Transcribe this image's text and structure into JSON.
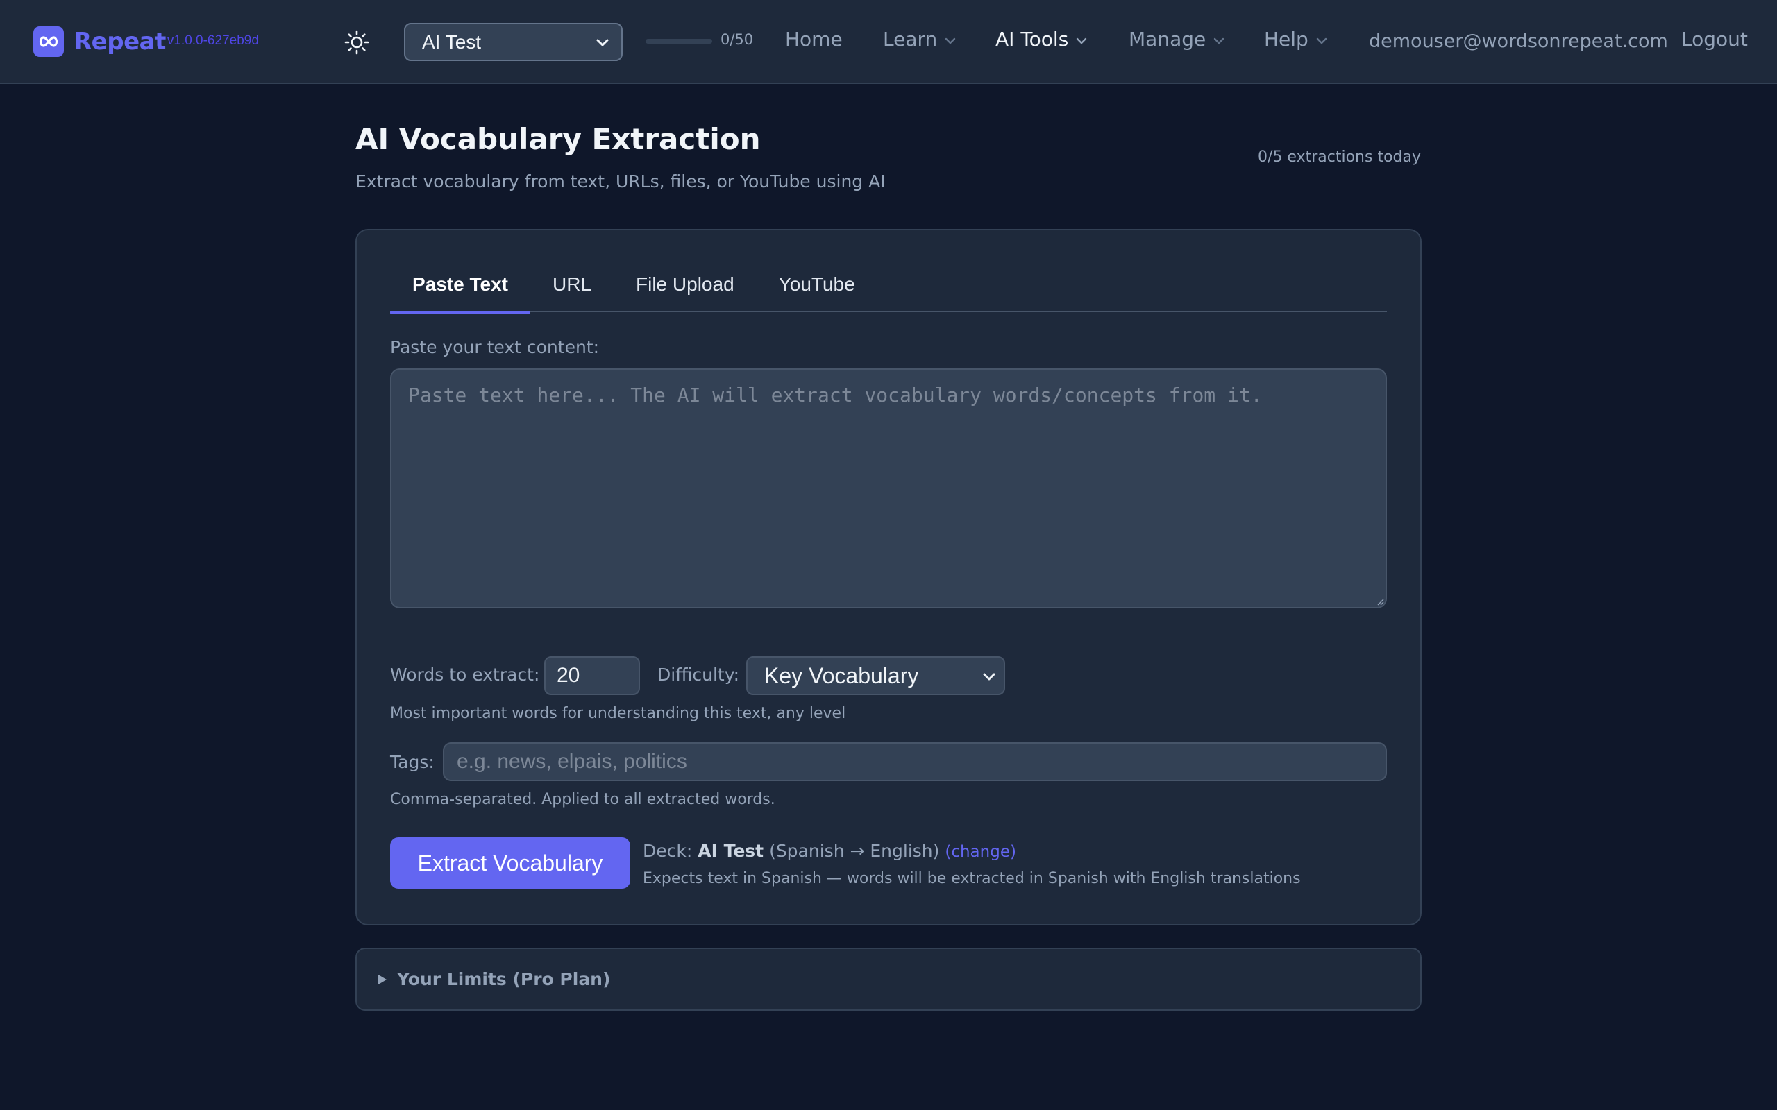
{
  "nav": {
    "brand_name": "Repeat",
    "version": "v1.0.0-627eb9d",
    "deck_selected": "AI Test",
    "progress_text": "0/50",
    "progress_fraction": 0,
    "items": {
      "home": "Home",
      "learn": "Learn",
      "ai_tools": "AI Tools",
      "manage": "Manage",
      "help": "Help"
    },
    "email": "demouser@wordsonrepeat.com",
    "logout": "Logout",
    "icons": {
      "logo": "infinity-icon",
      "theme": "sun-icon",
      "dropdown": "chevron-down-icon"
    },
    "accent_color": "#6366f1"
  },
  "header": {
    "title": "AI Vocabulary Extraction",
    "subtitle": "Extract vocabulary from text, URLs, files, or YouTube using AI",
    "extraction_count": "0/5 extractions today"
  },
  "form": {
    "tabs": [
      {
        "label": "Paste Text",
        "active": true
      },
      {
        "label": "URL",
        "active": false
      },
      {
        "label": "File Upload",
        "active": false
      },
      {
        "label": "YouTube",
        "active": false
      }
    ],
    "text_label": "Paste your text content:",
    "text_placeholder": "Paste text here... The AI will extract vocabulary words/concepts from it.",
    "text_value": "",
    "words_label": "Words to extract:",
    "words_value": "20",
    "difficulty_label": "Difficulty:",
    "difficulty_value": "Key Vocabulary",
    "difficulty_hint": "Most important words for understanding this text, any level",
    "tags_label": "Tags:",
    "tags_placeholder": "e.g. news, elpais, politics",
    "tags_hint": "Comma-separated. Applied to all extracted words.",
    "extract_button": "Extract Vocabulary",
    "deck_prefix": "Deck:",
    "deck_name": "AI Test",
    "deck_langs": "(Spanish → English)",
    "deck_change": "(change)",
    "deck_expect": "Expects text in Spanish — words will be extracted in Spanish with English translations"
  },
  "limits": {
    "label": "Your Limits (Pro Plan)"
  }
}
